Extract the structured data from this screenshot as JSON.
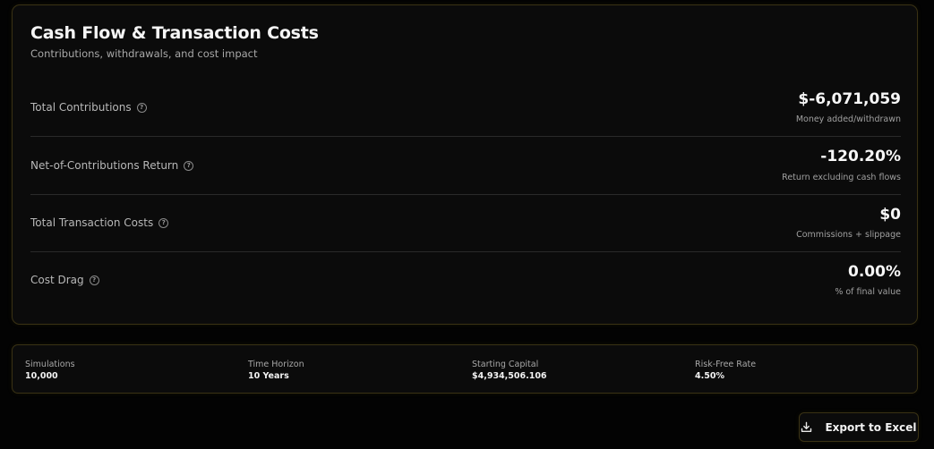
{
  "card": {
    "title": "Cash Flow & Transaction Costs",
    "subtitle": "Contributions, withdrawals, and cost impact",
    "help_glyph": "?",
    "metrics": [
      {
        "label": "Total Contributions",
        "value": "$-6,071,059",
        "sub": "Money added/withdrawn",
        "icon": "help-circle-icon"
      },
      {
        "label": "Net-of-Contributions Return",
        "value": "-120.20%",
        "sub": "Return excluding cash flows",
        "icon": "help-circle-icon"
      },
      {
        "label": "Total Transaction Costs",
        "value": "$0",
        "sub": "Commissions + slippage",
        "icon": "help-circle-icon"
      },
      {
        "label": "Cost Drag",
        "value": "0.00%",
        "sub": "% of final value",
        "icon": "help-circle-icon"
      }
    ]
  },
  "summary": {
    "items": [
      {
        "label": "Simulations",
        "value": "10,000"
      },
      {
        "label": "Time Horizon",
        "value": "10 Years"
      },
      {
        "label": "Starting Capital",
        "value": "$4,934,506.106"
      },
      {
        "label": "Risk-Free Rate",
        "value": "4.50%"
      }
    ]
  },
  "actions": {
    "export_label": "Export to Excel",
    "export_icon": "download-icon"
  },
  "colors": {
    "background": "#030303",
    "card": "#0b0b0b",
    "border_accent": "#3a3214",
    "text_primary": "#f5f5f5",
    "text_muted": "#a8a8a8"
  }
}
